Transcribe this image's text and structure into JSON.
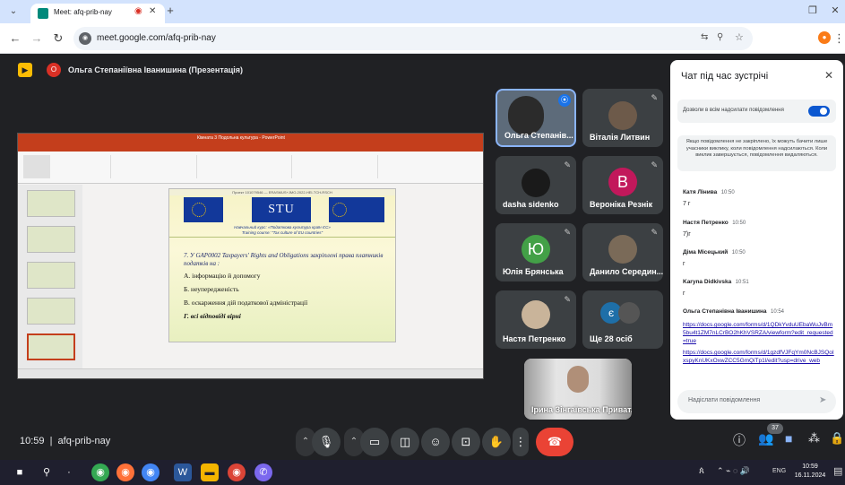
{
  "browser": {
    "tab_title": "Meet: afq-prib-nay",
    "url": "meet.google.com/afq-prib-nay"
  },
  "presenter_banner": "Ольга Степаніївна Іванишина (Презентація)",
  "slide": {
    "window_title": "Кімната 3 Подольна культура - PowerPoint",
    "header_text": "Проект 101079546 — ERASMUS+JMO-2022-HEI-TCH-RSCH",
    "stu_logo": "STU",
    "course_ua": "Навчальний курс: «Податкова культура країн ЄС»",
    "course_en": "Training course: \"Tax culture of EU countries\"",
    "question": "7. У GAP0002 Taxpayers' Rights and Obligations закріплені права платників податків на :",
    "options": [
      "А. інформацію й допомогу",
      "Б. неупередженість",
      "В. оскарження дій податкової адміністрації",
      "Г. всі відповіді вірні"
    ]
  },
  "participants": [
    {
      "name": "Ольга Степанів...",
      "type": "video",
      "speaking": true
    },
    {
      "name": "Віталія Литвин",
      "type": "photo"
    },
    {
      "name": "dasha sidenko",
      "type": "dark"
    },
    {
      "name": "Вероніка Резнік",
      "type": "letter",
      "letter": "В",
      "color": "#c2185b"
    },
    {
      "name": "Юлія Брянська",
      "type": "letter",
      "letter": "Ю",
      "color": "#43a047"
    },
    {
      "name": "Данило Середин...",
      "type": "photo"
    },
    {
      "name": "Настя Петренко",
      "type": "photo"
    },
    {
      "name": "Ще 28 осіб",
      "type": "more",
      "letter": "є"
    }
  ],
  "self_tile_name": "Ірина Зінгаївська Приват...",
  "chat": {
    "title": "Чат під час зустрічі",
    "toggle_label": "Дозволи в всім надсилати повідомлення",
    "toggle_on": true,
    "notice": "Якщо повідомлення не закріплено, їх можуть бачити лише учасники виклику, коли повідомлення надсилаються. Коли виклик завершується, повідомлення видаляються.",
    "messages": [
      {
        "name": "Катя Лінива",
        "time": "10:50",
        "text": "7 г"
      },
      {
        "name": "Настя Петренко",
        "time": "10:50",
        "text": "7)г"
      },
      {
        "name": "Діма Місецький",
        "time": "10:50",
        "text": "г"
      },
      {
        "name": "Karyna Didkivska",
        "time": "10:51",
        "text": "г"
      },
      {
        "name": "Ольга Степанівна Іванишина",
        "time": "10:54",
        "links": [
          "https://docs.google.com/forms/d/1QDkYvduUEbaWuJvBm5bu4t1ZM7nLCrBO2hKhVSRZA/viewform?edit_requested=true",
          "https://docs.google.com/forms/d/1gzdfVJFqYm0NcBJSQoIxspyKnUKxOxwZCC5GmQiTp1l/edit?usp=drive_web"
        ]
      }
    ],
    "input_placeholder": "Надіслати повідомлення"
  },
  "bottom": {
    "time": "10:59",
    "meeting_code": "afq-prib-nay",
    "people_count": "37"
  },
  "taskbar": {
    "lang": "ENG",
    "clock_time": "10:59",
    "clock_date": "16.11.2024"
  }
}
